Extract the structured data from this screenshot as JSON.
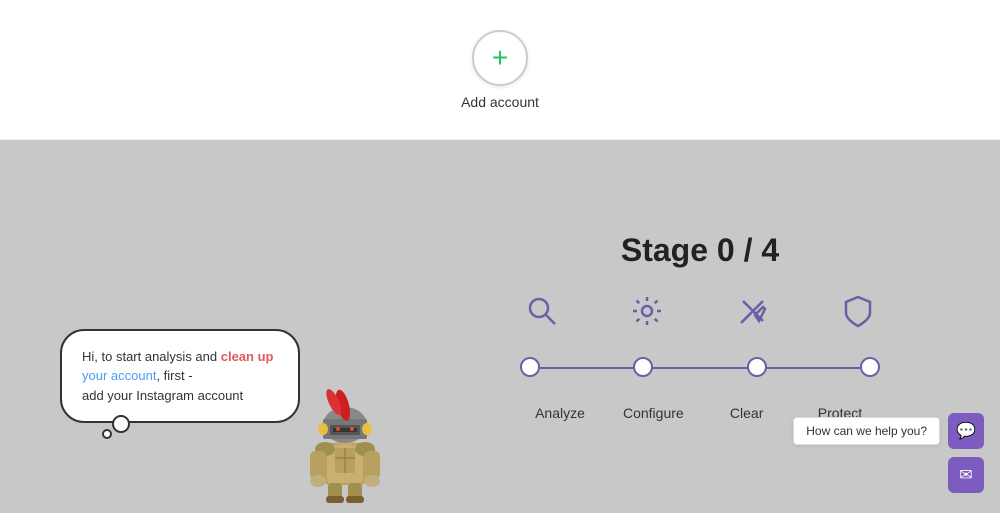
{
  "top": {
    "add_account_label": "Add account",
    "plus_symbol": "+"
  },
  "stage": {
    "title": "Stage 0 / 4",
    "steps": [
      {
        "id": "analyze",
        "label": "Analyze"
      },
      {
        "id": "configure",
        "label": "Configure"
      },
      {
        "id": "clear",
        "label": "Clear"
      },
      {
        "id": "protect",
        "label": "Protect"
      }
    ]
  },
  "speech": {
    "line1": "Hi, to start analysis and ",
    "highlight_clean": "clean up",
    "line2": " ",
    "highlight_your": "your account",
    "line3": ", first -\nadd your Instagram account"
  },
  "help": {
    "chat_label": "How can we help you?",
    "chat_icon": "💬",
    "email_icon": "✉"
  }
}
